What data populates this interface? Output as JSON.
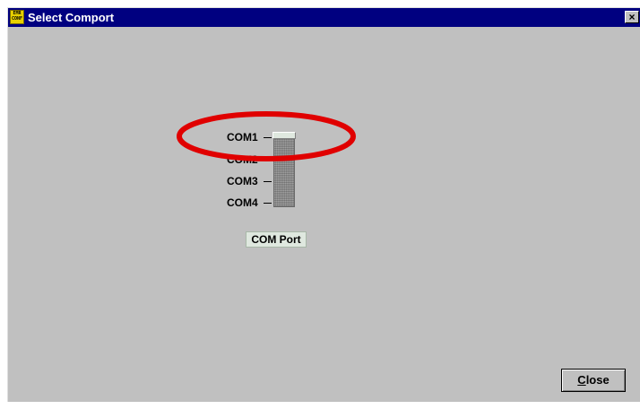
{
  "window": {
    "title": "Select Comport",
    "icon": {
      "name": "emr-conf-icon",
      "line1": "EMR",
      "line2": "CONF"
    },
    "close_glyph": "×"
  },
  "slider": {
    "labels": [
      "COM1",
      "COM2",
      "COM3",
      "COM4"
    ],
    "selected": "COM1",
    "caption": "COM Port"
  },
  "buttons": {
    "close_label_hotkey": "C",
    "close_label_rest": "lose"
  },
  "annotation": {
    "shape": "ellipse",
    "color": "#e00000"
  }
}
